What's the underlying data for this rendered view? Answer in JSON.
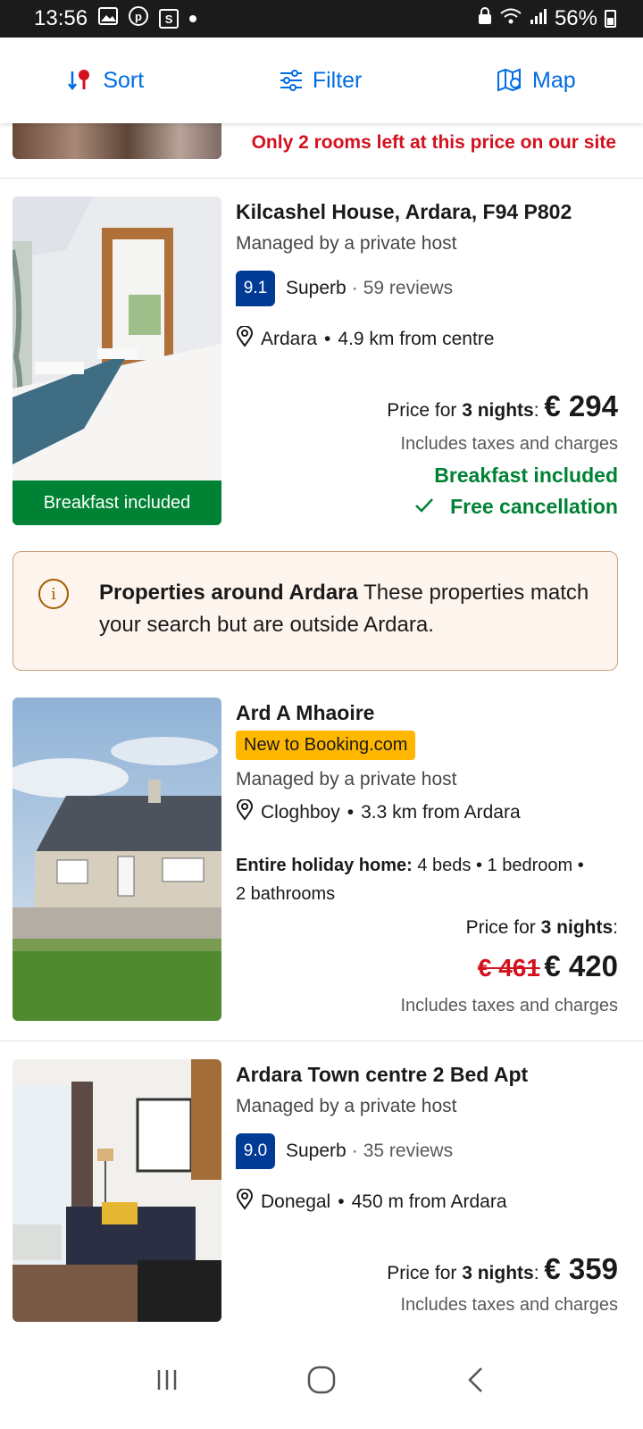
{
  "status_bar": {
    "time": "13:56",
    "notif_s": "S",
    "battery_pct": "56%"
  },
  "toolbar": {
    "sort_label": "Sort",
    "filter_label": "Filter",
    "map_label": "Map"
  },
  "top_fragment": {
    "urgent_text": "Only 2 rooms left at this price on our site"
  },
  "listings": [
    {
      "title": "Kilcashel House, Ardara, F94 P802",
      "host": "Managed by a private host",
      "score": "9.1",
      "score_word": "Superb",
      "reviews": "59 reviews",
      "location": "Ardara",
      "distance": "4.9 km from centre",
      "price_prefix": "Price for ",
      "nights": "3 nights",
      "price": "€ 294",
      "taxes": "Includes taxes and charges",
      "breakfast": "Breakfast included",
      "cancellation": "Free cancellation",
      "image_badge": "Breakfast included"
    },
    {
      "title": "Ard A Mhaoire",
      "badge": "New to Booking.com",
      "host": "Managed by a private host",
      "location": "Cloghboy",
      "distance": "3.3 km from Ardara",
      "unit_type": "Entire holiday home:",
      "unit_details_1": "4 beds • 1 bedroom •",
      "unit_details_2": "2 bathrooms",
      "price_prefix": "Price for ",
      "nights": "3 nights",
      "old_price": "€ 461",
      "price": "€ 420",
      "taxes": "Includes taxes and charges"
    },
    {
      "title": "Ardara Town centre 2 Bed Apt",
      "host": "Managed by a private host",
      "score": "9.0",
      "score_word": "Superb",
      "reviews": "35 reviews",
      "location": "Donegal",
      "distance": "450 m from Ardara",
      "price_prefix": "Price for ",
      "nights": "3 nights",
      "price": "€ 359",
      "taxes": "Includes taxes and charges"
    }
  ],
  "banner": {
    "bold": "Properties around Ardara",
    "text": " These properties match your search but are outside Ardara."
  },
  "colors": {
    "accent": "#006ce4",
    "score_bg": "#003b95",
    "green": "#008234",
    "urgent_red": "#d4111e",
    "badge_yellow": "#ffb700"
  }
}
